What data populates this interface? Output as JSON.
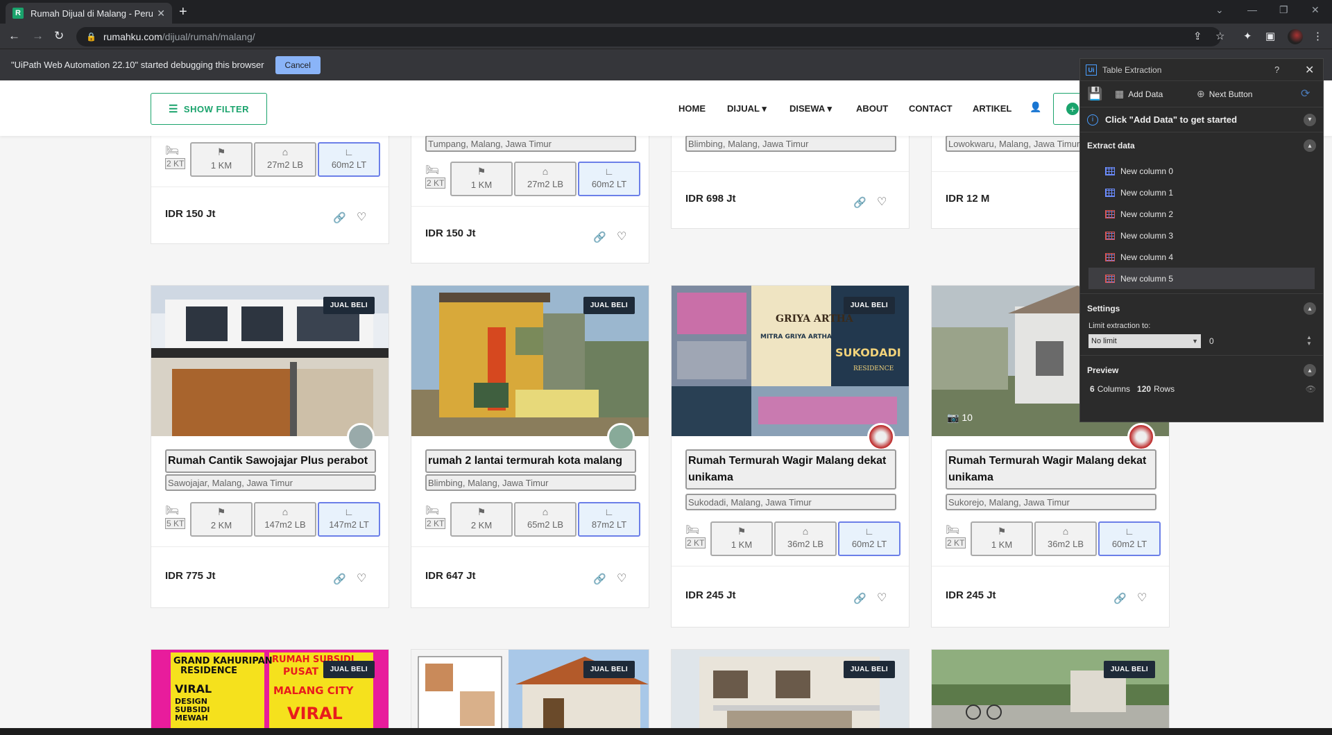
{
  "browser": {
    "tab_title": "Rumah Dijual di Malang - Perum",
    "favicon_letter": "R",
    "url_domain": "rumahku.com",
    "url_path": "/dijual/rumah/malang/"
  },
  "debug_bar": {
    "message": "\"UiPath Web Automation 22.10\" started debugging this browser",
    "cancel_label": "Cancel"
  },
  "site": {
    "show_filter_label": "SHOW FILTER",
    "nav": [
      "HOME",
      "DIJUAL",
      "DISEWA",
      "ABOUT",
      "CONTACT",
      "ARTIKEL"
    ]
  },
  "cards_top": [
    {
      "location": "",
      "kt": "2 KT",
      "km": "1 KM",
      "lb": "27m2 LB",
      "lt": "60m2 LT",
      "price": "IDR 150 Jt"
    },
    {
      "location": "Tumpang, Malang, Jawa Timur",
      "kt": "2 KT",
      "km": "1 KM",
      "lb": "27m2 LB",
      "lt": "60m2 LT",
      "price": "IDR 150 Jt"
    },
    {
      "location": "Blimbing, Malang, Jawa Timur",
      "price": "IDR 698 Jt"
    },
    {
      "location": "Lowokwaru, Malang, Jawa Timur",
      "price": "IDR 12 M"
    }
  ],
  "cards_mid": [
    {
      "badge": "JUAL BELI",
      "title": "Rumah Cantik Sawojajar Plus perabot",
      "location": "Sawojajar, Malang, Jawa Timur",
      "kt": "5 KT",
      "km": "2 KM",
      "lb": "147m2 LB",
      "lt": "147m2 LT",
      "price": "IDR 775 Jt"
    },
    {
      "badge": "JUAL BELI",
      "title": "rumah 2 lantai termurah kota malang",
      "location": "Blimbing, Malang, Jawa Timur",
      "kt": "2 KT",
      "km": "2 KM",
      "lb": "65m2 LB",
      "lt": "87m2 LT",
      "price": "IDR 647 Jt"
    },
    {
      "badge": "JUAL BELI",
      "title": "Rumah Termurah Wagir Malang dekat unikama",
      "location": "Sukodadi, Malang, Jawa Timur",
      "kt": "2 KT",
      "km": "1 KM",
      "lb": "36m2 LB",
      "lt": "60m2 LT",
      "price": "IDR 245 Jt",
      "photo_text": {
        "brand": "GRIYA ARTHA",
        "sub": "MITRA GRIYA ARTHA",
        "place": "SUKODADI",
        "res": "RESIDENCE"
      }
    },
    {
      "badge": "JUAL BELI",
      "title": "Rumah Termurah Wagir Malang dekat unikama",
      "location": "Sukorejo, Malang, Jawa Timur",
      "kt": "2 KT",
      "km": "1 KM",
      "lb": "36m2 LB",
      "lt": "60m2 LT",
      "price": "IDR 245 Jt",
      "photo_count": "10"
    }
  ],
  "cards_bottom": [
    {
      "badge": "JUAL BELI",
      "ad_left": [
        "GRAND KAHURIPAN",
        "RESIDENCE",
        "VIRAL",
        "DESIGN",
        "SUBSIDI",
        "MEWAH"
      ],
      "ad_right": [
        "RUMAH SUBSIDI",
        "PUSAT",
        "MALANG CITY",
        "VIRAL"
      ]
    },
    {
      "badge": "JUAL BELI"
    },
    {
      "badge": "JUAL BELI"
    },
    {
      "badge": "JUAL BELI"
    }
  ],
  "panel": {
    "title": "Table Extraction",
    "help": "?",
    "add_data": "Add Data",
    "next_button": "Next Button",
    "info": "Click \"Add Data\" to get started",
    "extract_title": "Extract data",
    "columns": [
      "New column 0",
      "New column 1",
      "New column 2",
      "New column 3",
      "New column 4",
      "New column 5"
    ],
    "settings_title": "Settings",
    "limit_label": "Limit extraction to:",
    "limit_value": "No limit",
    "limit_number": "0",
    "preview_title": "Preview",
    "preview_columns": "6",
    "preview_columns_label": "Columns",
    "preview_rows": "120",
    "preview_rows_label": "Rows"
  }
}
